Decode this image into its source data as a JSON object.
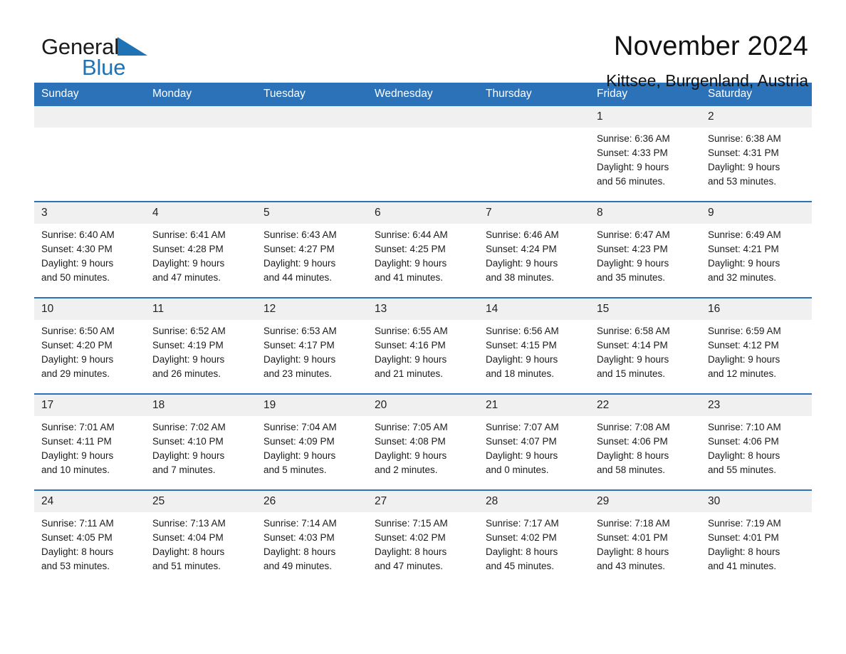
{
  "brand": {
    "word1": "General",
    "word2": "Blue",
    "triangle_color": "#1f73b5"
  },
  "header": {
    "title": "November 2024",
    "subtitle": "Kittsee, Burgenland, Austria",
    "accent_color": "#2b72b8",
    "daynum_bg": "#f0f0f0"
  },
  "calendar": {
    "weekday_headers": [
      "Sunday",
      "Monday",
      "Tuesday",
      "Wednesday",
      "Thursday",
      "Friday",
      "Saturday"
    ],
    "labels": {
      "sunrise": "Sunrise:",
      "sunset": "Sunset:",
      "daylight": "Daylight:"
    },
    "weeks": [
      [
        {
          "day": "",
          "empty": true
        },
        {
          "day": "",
          "empty": true
        },
        {
          "day": "",
          "empty": true
        },
        {
          "day": "",
          "empty": true
        },
        {
          "day": "",
          "empty": true
        },
        {
          "day": "1",
          "sunrise": "Sunrise: 6:36 AM",
          "sunset": "Sunset: 4:33 PM",
          "daylight_line1": "Daylight: 9 hours",
          "daylight_line2": "and 56 minutes."
        },
        {
          "day": "2",
          "sunrise": "Sunrise: 6:38 AM",
          "sunset": "Sunset: 4:31 PM",
          "daylight_line1": "Daylight: 9 hours",
          "daylight_line2": "and 53 minutes."
        }
      ],
      [
        {
          "day": "3",
          "sunrise": "Sunrise: 6:40 AM",
          "sunset": "Sunset: 4:30 PM",
          "daylight_line1": "Daylight: 9 hours",
          "daylight_line2": "and 50 minutes."
        },
        {
          "day": "4",
          "sunrise": "Sunrise: 6:41 AM",
          "sunset": "Sunset: 4:28 PM",
          "daylight_line1": "Daylight: 9 hours",
          "daylight_line2": "and 47 minutes."
        },
        {
          "day": "5",
          "sunrise": "Sunrise: 6:43 AM",
          "sunset": "Sunset: 4:27 PM",
          "daylight_line1": "Daylight: 9 hours",
          "daylight_line2": "and 44 minutes."
        },
        {
          "day": "6",
          "sunrise": "Sunrise: 6:44 AM",
          "sunset": "Sunset: 4:25 PM",
          "daylight_line1": "Daylight: 9 hours",
          "daylight_line2": "and 41 minutes."
        },
        {
          "day": "7",
          "sunrise": "Sunrise: 6:46 AM",
          "sunset": "Sunset: 4:24 PM",
          "daylight_line1": "Daylight: 9 hours",
          "daylight_line2": "and 38 minutes."
        },
        {
          "day": "8",
          "sunrise": "Sunrise: 6:47 AM",
          "sunset": "Sunset: 4:23 PM",
          "daylight_line1": "Daylight: 9 hours",
          "daylight_line2": "and 35 minutes."
        },
        {
          "day": "9",
          "sunrise": "Sunrise: 6:49 AM",
          "sunset": "Sunset: 4:21 PM",
          "daylight_line1": "Daylight: 9 hours",
          "daylight_line2": "and 32 minutes."
        }
      ],
      [
        {
          "day": "10",
          "sunrise": "Sunrise: 6:50 AM",
          "sunset": "Sunset: 4:20 PM",
          "daylight_line1": "Daylight: 9 hours",
          "daylight_line2": "and 29 minutes."
        },
        {
          "day": "11",
          "sunrise": "Sunrise: 6:52 AM",
          "sunset": "Sunset: 4:19 PM",
          "daylight_line1": "Daylight: 9 hours",
          "daylight_line2": "and 26 minutes."
        },
        {
          "day": "12",
          "sunrise": "Sunrise: 6:53 AM",
          "sunset": "Sunset: 4:17 PM",
          "daylight_line1": "Daylight: 9 hours",
          "daylight_line2": "and 23 minutes."
        },
        {
          "day": "13",
          "sunrise": "Sunrise: 6:55 AM",
          "sunset": "Sunset: 4:16 PM",
          "daylight_line1": "Daylight: 9 hours",
          "daylight_line2": "and 21 minutes."
        },
        {
          "day": "14",
          "sunrise": "Sunrise: 6:56 AM",
          "sunset": "Sunset: 4:15 PM",
          "daylight_line1": "Daylight: 9 hours",
          "daylight_line2": "and 18 minutes."
        },
        {
          "day": "15",
          "sunrise": "Sunrise: 6:58 AM",
          "sunset": "Sunset: 4:14 PM",
          "daylight_line1": "Daylight: 9 hours",
          "daylight_line2": "and 15 minutes."
        },
        {
          "day": "16",
          "sunrise": "Sunrise: 6:59 AM",
          "sunset": "Sunset: 4:12 PM",
          "daylight_line1": "Daylight: 9 hours",
          "daylight_line2": "and 12 minutes."
        }
      ],
      [
        {
          "day": "17",
          "sunrise": "Sunrise: 7:01 AM",
          "sunset": "Sunset: 4:11 PM",
          "daylight_line1": "Daylight: 9 hours",
          "daylight_line2": "and 10 minutes."
        },
        {
          "day": "18",
          "sunrise": "Sunrise: 7:02 AM",
          "sunset": "Sunset: 4:10 PM",
          "daylight_line1": "Daylight: 9 hours",
          "daylight_line2": "and 7 minutes."
        },
        {
          "day": "19",
          "sunrise": "Sunrise: 7:04 AM",
          "sunset": "Sunset: 4:09 PM",
          "daylight_line1": "Daylight: 9 hours",
          "daylight_line2": "and 5 minutes."
        },
        {
          "day": "20",
          "sunrise": "Sunrise: 7:05 AM",
          "sunset": "Sunset: 4:08 PM",
          "daylight_line1": "Daylight: 9 hours",
          "daylight_line2": "and 2 minutes."
        },
        {
          "day": "21",
          "sunrise": "Sunrise: 7:07 AM",
          "sunset": "Sunset: 4:07 PM",
          "daylight_line1": "Daylight: 9 hours",
          "daylight_line2": "and 0 minutes."
        },
        {
          "day": "22",
          "sunrise": "Sunrise: 7:08 AM",
          "sunset": "Sunset: 4:06 PM",
          "daylight_line1": "Daylight: 8 hours",
          "daylight_line2": "and 58 minutes."
        },
        {
          "day": "23",
          "sunrise": "Sunrise: 7:10 AM",
          "sunset": "Sunset: 4:06 PM",
          "daylight_line1": "Daylight: 8 hours",
          "daylight_line2": "and 55 minutes."
        }
      ],
      [
        {
          "day": "24",
          "sunrise": "Sunrise: 7:11 AM",
          "sunset": "Sunset: 4:05 PM",
          "daylight_line1": "Daylight: 8 hours",
          "daylight_line2": "and 53 minutes."
        },
        {
          "day": "25",
          "sunrise": "Sunrise: 7:13 AM",
          "sunset": "Sunset: 4:04 PM",
          "daylight_line1": "Daylight: 8 hours",
          "daylight_line2": "and 51 minutes."
        },
        {
          "day": "26",
          "sunrise": "Sunrise: 7:14 AM",
          "sunset": "Sunset: 4:03 PM",
          "daylight_line1": "Daylight: 8 hours",
          "daylight_line2": "and 49 minutes."
        },
        {
          "day": "27",
          "sunrise": "Sunrise: 7:15 AM",
          "sunset": "Sunset: 4:02 PM",
          "daylight_line1": "Daylight: 8 hours",
          "daylight_line2": "and 47 minutes."
        },
        {
          "day": "28",
          "sunrise": "Sunrise: 7:17 AM",
          "sunset": "Sunset: 4:02 PM",
          "daylight_line1": "Daylight: 8 hours",
          "daylight_line2": "and 45 minutes."
        },
        {
          "day": "29",
          "sunrise": "Sunrise: 7:18 AM",
          "sunset": "Sunset: 4:01 PM",
          "daylight_line1": "Daylight: 8 hours",
          "daylight_line2": "and 43 minutes."
        },
        {
          "day": "30",
          "sunrise": "Sunrise: 7:19 AM",
          "sunset": "Sunset: 4:01 PM",
          "daylight_line1": "Daylight: 8 hours",
          "daylight_line2": "and 41 minutes."
        }
      ]
    ]
  }
}
